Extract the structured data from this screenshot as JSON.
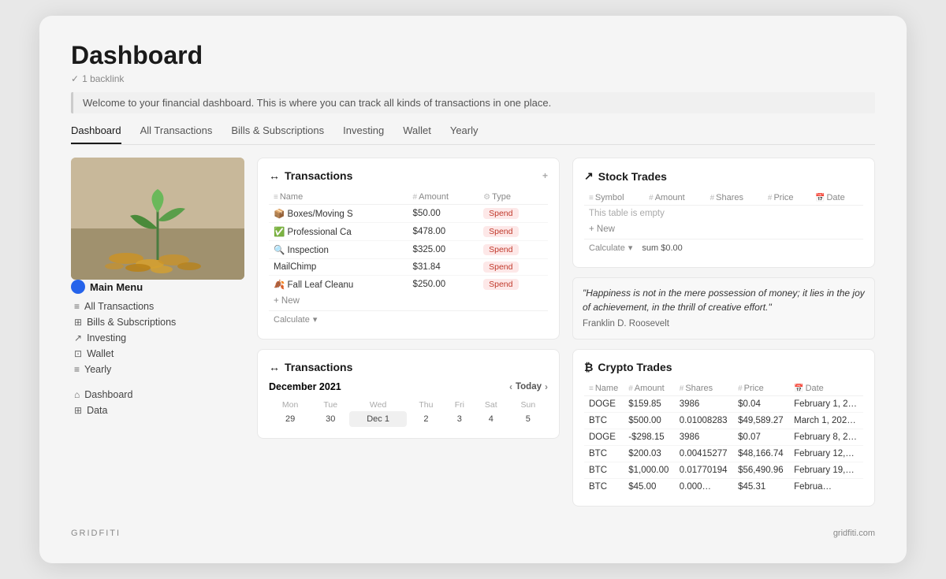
{
  "page": {
    "title": "Dashboard",
    "backlink": "1 backlink",
    "welcome": "Welcome to your financial dashboard. This is where you can track all kinds of transactions in one place."
  },
  "tabs": [
    {
      "label": "Dashboard",
      "active": true
    },
    {
      "label": "All Transactions",
      "active": false
    },
    {
      "label": "Bills & Subscriptions",
      "active": false
    },
    {
      "label": "Investing",
      "active": false
    },
    {
      "label": "Wallet",
      "active": false
    },
    {
      "label": "Yearly",
      "active": false
    }
  ],
  "sidebar": {
    "main_menu_label": "Main Menu",
    "items": [
      {
        "label": "All Transactions",
        "icon": "≡"
      },
      {
        "label": "Bills & Subscriptions",
        "icon": "⊞"
      },
      {
        "label": "Investing",
        "icon": "↗"
      },
      {
        "label": "Wallet",
        "icon": "⊡"
      },
      {
        "label": "Yearly",
        "icon": "≡"
      }
    ],
    "secondary_items": [
      {
        "label": "Dashboard",
        "icon": "⌂"
      },
      {
        "label": "Data",
        "icon": "⊞"
      }
    ]
  },
  "transactions": {
    "title": "Transactions",
    "icon": "↔",
    "columns": [
      "Name",
      "Amount",
      "Type"
    ],
    "rows": [
      {
        "name": "Boxes/Moving S",
        "icon": "📦",
        "amount": "$50.00",
        "type": "Spend"
      },
      {
        "name": "Professional Ca",
        "icon": "✅",
        "amount": "$478.00",
        "type": "Spend"
      },
      {
        "name": "Inspection",
        "icon": "🔍",
        "amount": "$325.00",
        "type": "Spend"
      },
      {
        "name": "MailChimp",
        "icon": "",
        "amount": "$31.84",
        "type": "Spend"
      },
      {
        "name": "Fall Leaf Cleanu",
        "icon": "🍂",
        "amount": "$250.00",
        "type": "Spend"
      }
    ],
    "add_new": "+ New",
    "calculate": "Calculate"
  },
  "calendar": {
    "title": "Transactions",
    "icon": "↔",
    "month_year": "December 2021",
    "nav_prev": "‹",
    "nav_next": "›",
    "today_label": "Today",
    "days": [
      "Mon",
      "Tue",
      "Wed",
      "Thu",
      "Fri",
      "Sat",
      "Sun"
    ],
    "weeks": [
      [
        "29",
        "30",
        "Dec 1",
        "2",
        "3",
        "4",
        "5"
      ]
    ]
  },
  "stock_trades": {
    "title": "Stock Trades",
    "icon": "↗",
    "columns": [
      "Symbol",
      "Amount",
      "Shares",
      "Price",
      "Date"
    ],
    "empty_msg": "This table is empty",
    "add_new": "+ New",
    "calculate": "Calculate",
    "sum_label": "sum $0.00"
  },
  "quote": {
    "text": "\"Happiness is not in the mere possession of money; it lies in the joy of achievement, in the thrill of creative effort.\"",
    "author": "Franklin D. Roosevelt"
  },
  "crypto_trades": {
    "title": "Crypto Trades",
    "icon": "₿",
    "columns": [
      "Name",
      "Amount",
      "Shares",
      "Price",
      "Date"
    ],
    "rows": [
      {
        "name": "DOGE",
        "amount": "$159.85",
        "shares": "3986",
        "price": "$0.04",
        "date": "February 1, 2…"
      },
      {
        "name": "BTC",
        "amount": "$500.00",
        "shares": "0.01008283",
        "price": "$49,589.27",
        "date": "March 1, 202…"
      },
      {
        "name": "DOGE",
        "amount": "-$298.15",
        "shares": "3986",
        "price": "$0.07",
        "date": "February 8, 2…"
      },
      {
        "name": "BTC",
        "amount": "$200.03",
        "shares": "0.00415277",
        "price": "$48,166.74",
        "date": "February 12,…"
      },
      {
        "name": "BTC",
        "amount": "$1,000.00",
        "shares": "0.01770194",
        "price": "$56,490.96",
        "date": "February 19,…"
      },
      {
        "name": "BTC",
        "amount": "$45.00",
        "shares": "0.000…",
        "price": "$45.31",
        "date": "Februa…"
      }
    ]
  },
  "footer": {
    "brand_left": "GRIDFITI",
    "brand_right": "gridfiti.com"
  }
}
